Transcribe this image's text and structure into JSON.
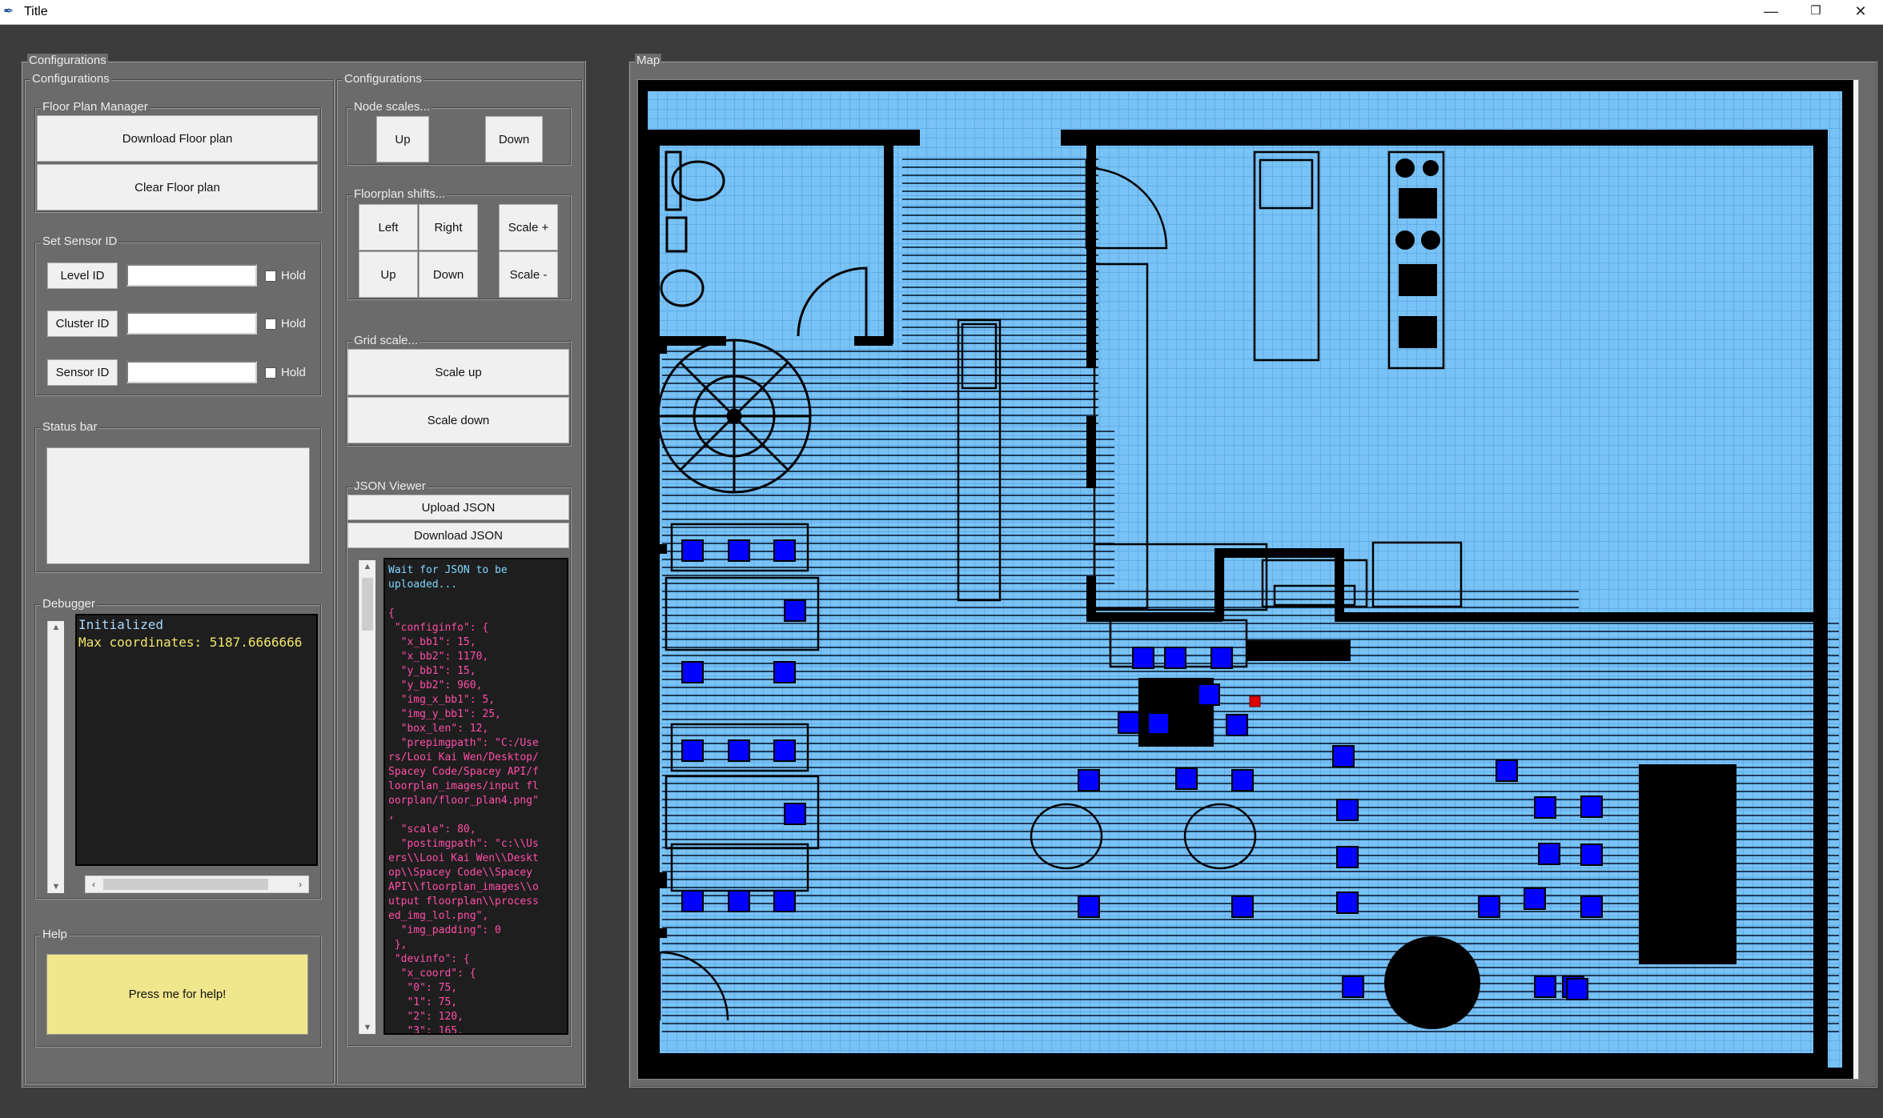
{
  "window": {
    "title": "Title",
    "minimize": "—",
    "restore": "❐",
    "close": "✕"
  },
  "left": {
    "outer_label": "Configurations",
    "inner_label": "Configurations",
    "floor_plan_manager": {
      "label": "Floor Plan Manager",
      "download": "Download Floor plan",
      "clear": "Clear Floor plan"
    },
    "set_sensor_id": {
      "label": "Set Sensor ID",
      "rows": [
        {
          "button": "Level ID",
          "value": "",
          "hold": "Hold"
        },
        {
          "button": "Cluster ID",
          "value": "",
          "hold": "Hold"
        },
        {
          "button": "Sensor ID",
          "value": "",
          "hold": "Hold"
        }
      ]
    },
    "status_bar": {
      "label": "Status bar",
      "text": ""
    },
    "debugger": {
      "label": "Debugger",
      "lines": [
        "Initialized",
        "Max coordinates: 5187.6666666"
      ]
    },
    "help": {
      "label": "Help",
      "button": "Press me for help!"
    }
  },
  "mid": {
    "label": "Configurations",
    "node_scales": {
      "label": "Node scales...",
      "up": "Up",
      "down": "Down"
    },
    "floorplan_shifts": {
      "label": "Floorplan shifts...",
      "left": "Left",
      "right": "Right",
      "up": "Up",
      "down": "Down",
      "scale_plus": "Scale +",
      "scale_minus": "Scale -"
    },
    "grid_scale": {
      "label": "Grid scale...",
      "scale_up": "Scale up",
      "scale_down": "Scale down"
    },
    "json_viewer": {
      "label": "JSON Viewer",
      "upload": "Upload JSON",
      "download": "Download JSON",
      "lines": [
        {
          "t": "Wait for JSON to be",
          "c": "#7fd6ff"
        },
        {
          "t": "uploaded...",
          "c": "#7fd6ff"
        },
        {
          "t": "",
          "c": "#ff4fa8"
        },
        {
          "t": "{",
          "c": "#ff4fa8"
        },
        {
          "t": " \"configinfo\": {",
          "c": "#ff4fa8"
        },
        {
          "t": "  \"x_bb1\": 15,",
          "c": "#ff4fa8"
        },
        {
          "t": "  \"x_bb2\": 1170,",
          "c": "#ff4fa8"
        },
        {
          "t": "  \"y_bb1\": 15,",
          "c": "#ff4fa8"
        },
        {
          "t": "  \"y_bb2\": 960,",
          "c": "#ff4fa8"
        },
        {
          "t": "  \"img_x_bb1\": 5,",
          "c": "#ff4fa8"
        },
        {
          "t": "  \"img_y_bb1\": 25,",
          "c": "#ff4fa8"
        },
        {
          "t": "  \"box_len\": 12,",
          "c": "#ff4fa8"
        },
        {
          "t": "  \"prepimgpath\": \"C:/Use",
          "c": "#ff4fa8"
        },
        {
          "t": "rs/Looi Kai Wen/Desktop/",
          "c": "#ff4fa8"
        },
        {
          "t": "Spacey Code/Spacey API/f",
          "c": "#ff4fa8"
        },
        {
          "t": "loorplan_images/input fl",
          "c": "#ff4fa8"
        },
        {
          "t": "oorplan/floor_plan4.png\"",
          "c": "#ff4fa8"
        },
        {
          "t": ",",
          "c": "#ff4fa8"
        },
        {
          "t": "  \"scale\": 80,",
          "c": "#ff4fa8"
        },
        {
          "t": "  \"postimgpath\": \"c:\\\\Us",
          "c": "#ff4fa8"
        },
        {
          "t": "ers\\\\Looi Kai Wen\\\\Deskt",
          "c": "#ff4fa8"
        },
        {
          "t": "op\\\\Spacey Code\\\\Spacey",
          "c": "#ff4fa8"
        },
        {
          "t": "API\\\\floorplan_images\\\\o",
          "c": "#ff4fa8"
        },
        {
          "t": "utput floorplan\\\\process",
          "c": "#ff4fa8"
        },
        {
          "t": "ed_img_lol.png\",",
          "c": "#ff4fa8"
        },
        {
          "t": "  \"img_padding\": 0",
          "c": "#ff4fa8"
        },
        {
          "t": " },",
          "c": "#ff4fa8"
        },
        {
          "t": " \"devinfo\": {",
          "c": "#ff4fa8"
        },
        {
          "t": "  \"x_coord\": {",
          "c": "#ff4fa8"
        },
        {
          "t": "   \"0\": 75,",
          "c": "#ff4fa8"
        },
        {
          "t": "   \"1\": 75,",
          "c": "#ff4fa8"
        },
        {
          "t": "   \"2\": 120,",
          "c": "#ff4fa8"
        },
        {
          "t": "   \"3\": 165,",
          "c": "#ff4fa8"
        }
      ]
    }
  },
  "map": {
    "label": "Map"
  },
  "colors": {
    "grid_bg": "#78c2f5",
    "grid_line": "#5aa8e6",
    "sensor": "#0000ff",
    "marker": "#e00000"
  }
}
